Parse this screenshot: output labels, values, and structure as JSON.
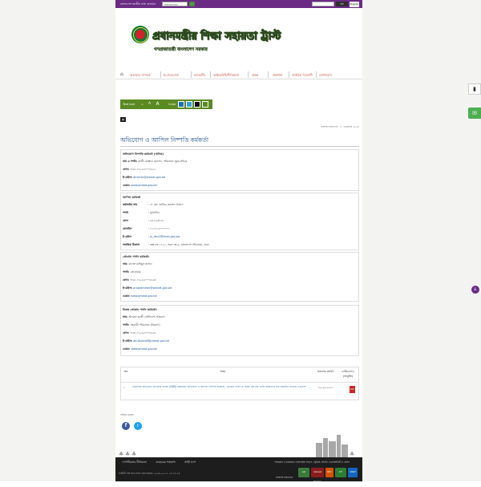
{
  "topbar": {
    "title": "বাংলাদেশ জাতীয় তথ্য বাতায়ন",
    "select_value": "অফিসের ধরন",
    "go_label": "⇨",
    "search_button": "সার্চ",
    "lang_button": "English"
  },
  "header": {
    "title": "প্রধানমন্ত্রীর শিক্ষা সহায়তা ট্রাস্ট",
    "subtitle": "গণপ্রজাতন্ত্রী বাংলাদেশ সরকার"
  },
  "nav": {
    "items": [
      {
        "label": "আমাদের সম্পর্কে"
      },
      {
        "label": "ই-সেবা/সেবা"
      },
      {
        "label": "ম্যান্ডেটরি"
      },
      {
        "label": "আইন/বিধি/নীতিমালা"
      },
      {
        "label": "প্রকল্প"
      },
      {
        "label": "প্রকাশনা"
      },
      {
        "label": "দাপ্তরিক পত্রাবলী"
      },
      {
        "label": "যোগাযোগ"
      }
    ]
  },
  "access": {
    "label": "Text size",
    "font_small": "A",
    "font_medium": "A",
    "font_large": "A",
    "color_label": "Color",
    "colors": [
      "#1e6fb5",
      "#3a9bd8",
      "#111111",
      "#5a8a22"
    ]
  },
  "print": {
    "label": "🖶"
  },
  "date_line": "সর্বশেষ হালনাগাদ: ১১ ফেব্রুয়ারি ২০২৪",
  "page_title": "অভিযোগ ও আপিল নিষ্পত্তি কর্মকর্তা",
  "card1": {
    "heading": "অভিযোগ নিষ্পত্তি কর্মকর্তা (অনিক)",
    "name": "নাম ও পদবি:",
    "name_val": "কাজী মোস্তফা হোসেন, পরিচালক (যুগ্ম-সচিব)",
    "phone": "ফোন:",
    "phone_val": "+৮৮-০২-৫৫০০৭৪২২",
    "email": "ই-মেইল:",
    "email_val": "director@pmeat.gov.bd",
    "web": "ওয়েব:",
    "web_val": "www.pmeat.gov.bd"
  },
  "card2": {
    "heading": "আপিল কর্মকর্তা",
    "rows": [
      {
        "k": "কর্মকর্তার নাম",
        "v": ": ড. মো: জাকির হোসেন আকন্দ"
      },
      {
        "k": "পদবি",
        "v": ": যুগ্মসচিব"
      },
      {
        "k": "ফোন",
        "v": ": ৯৫৭২৩৭৪১"
      },
      {
        "k": "মোবাইল",
        "v": ": ০১৭১১৮০০০০০"
      },
      {
        "k": "ই-মেইল",
        "v": ": js_dev2@shed.gov.bd"
      },
      {
        "k": "দাপ্তরিক ঠিকানা",
        "v": ": কক্ষ নং-১৭২১, ভবন নং-৬, বাংলাদেশ সচিবালয়, ঢাকা"
      }
    ]
  },
  "card3": {
    "heading": "প্রোগ্রাম পার্সন কর্মকর্তা:",
    "name": "নাম:",
    "name_val": "রাসেল মাহিমুল হাসান",
    "desig": "পদবি:",
    "desig_val": "প্রোগ্রামার",
    "phone": "ফোন:",
    "phone_val": "+৮৮-০২-৫৫০০৭৪২৩",
    "email": "ই-মেইল:",
    "email_val": "programmer@pmeat.gov.bd",
    "web": "ওয়েব:",
    "web_val": "www.pmeat.gov.bd"
  },
  "card4": {
    "heading": "বিকল্প প্রোগ্রাম পার্সন কর্মকর্তা:",
    "name": "নাম:",
    "name_val": "আমেনা কাজী প্রেসিডেন্ট আহমেদ",
    "desig": "পদবি:",
    "desig_val": "সহকারী পরিচালক (বিতরণ)",
    "phone": "ফোন:",
    "phone_val": "+৮৮-০২-৫৫০০৭৪২৪",
    "email": "ই-মেইল:",
    "email_val": "ad.stipend@pmeat.gov.bd",
    "web": "ওয়েব:",
    "web_val": "www.pmeat.gov.bd"
  },
  "table": {
    "headers": [
      "ক্রম",
      "বিষয়",
      "প্রকাশের তারিখ",
      "ডাউনলোড (সংযুক্তি)"
    ],
    "rows": [
      {
        "serial": "১",
        "subject": "ত্রৈমাসিক অভিযোগ প্রতিকার ব্যবস্থা (GRS) বাস্তবায়ন অভিযোগ ও আপিল নিষ্পত্তি কর্মকর্তা, প্রোগ্রাম পার্সন ও বিকল্প প্রোগ্রাম পার্সন কর্মকর্তার নাম প্রকাশের সংক্রান্ত পত্রাদেশ",
        "date": "২০-০৬-২০২১",
        "file": "PDF"
      }
    ]
  },
  "share": {
    "label": "শেয়ার করুন:",
    "fb": "f",
    "tw": "t"
  },
  "footer": {
    "links": [
      "গোপনীয়তার নীতিমালা",
      "ব্যবহারের শর্তাবলি",
      "সাইট ম্যাপ"
    ],
    "updated": "সাইটটি শেষ হাল-নাগাদ করা হয়েছে: ২০২৪-০২-১৫ ০৭:২৮:৫৪",
    "partners": "পরিকল্পনা ও বাস্তবায়নে: মন্ত্রিপরিষদ বিভাগ, এটুআই, বিসিসি, ডিওআইসিটি ও বেসিস",
    "plan": "কারিগরি সহায়তায়:",
    "logos": [
      "a2i",
      "Cabinet Division",
      "BCC",
      "ICT",
      "UNDP"
    ]
  },
  "colors": {
    "topbar": "#6b2a84",
    "nav_text": "#c0392b",
    "access": "#5a8a22",
    "title": "#1a4c8b"
  }
}
